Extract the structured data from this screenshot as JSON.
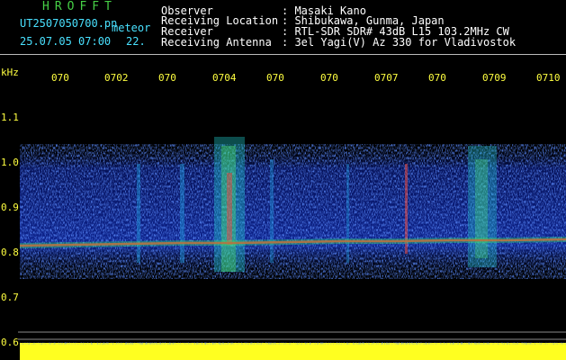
{
  "station": {
    "name": "HROFFT",
    "filename": "UT2507050700.pn",
    "type": "meteor",
    "date_time": "25.07.05 07:00",
    "count": "22."
  },
  "info": {
    "rows": [
      {
        "label": "Observer",
        "value": ": Masaki Kano"
      },
      {
        "label": "Receiving Location",
        "value": ": Shibukawa, Gunma, Japan"
      },
      {
        "label": "Receiver",
        "value": ": RTL-SDR SDR# 43dB L15 103.2MHz CW"
      },
      {
        "label": "Receiving Antenna",
        "value": ": 3el Yagi(V) Az 330 for Vladivostok"
      }
    ]
  },
  "axis": {
    "unit": "kHz",
    "x_ticks": [
      "070",
      "0702",
      "070",
      "0704",
      "070",
      "070",
      "0707",
      "070",
      "0709",
      "0710"
    ],
    "y_ticks": [
      "1.1",
      "1.0",
      "0.9",
      "0.8",
      "0.7",
      "0.6"
    ]
  },
  "colors": {
    "background": "#000000",
    "title_green": "#46d046",
    "label_cyan": "#49e1ff",
    "tick_yellow": "#ffff40",
    "noise_blue": "#1c3cc8",
    "signal_red": "#ff3030"
  }
}
